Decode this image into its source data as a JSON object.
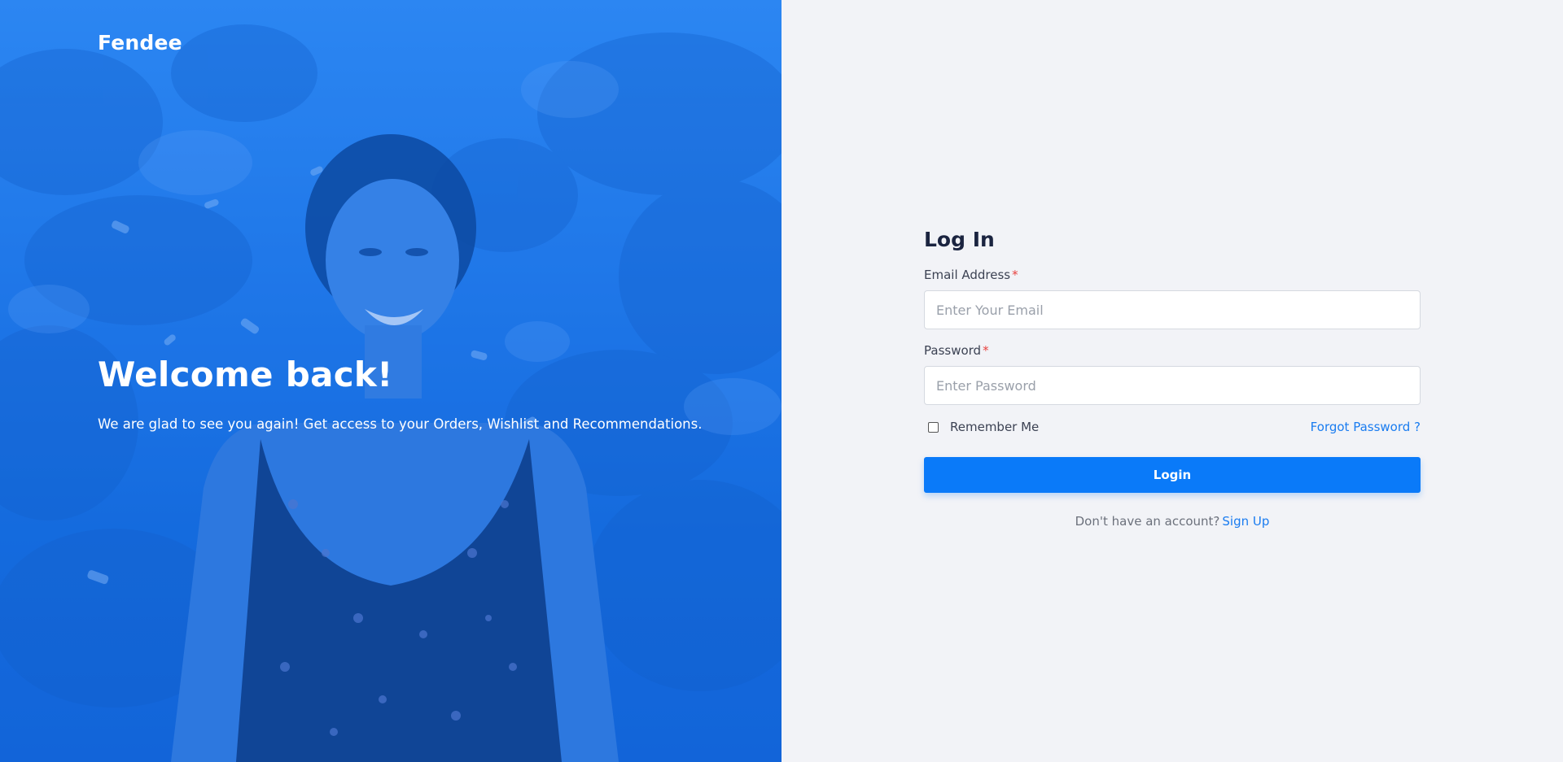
{
  "brand": {
    "name": "Fendee"
  },
  "hero": {
    "title": "Welcome back!",
    "subtitle": "We are glad to see you again! Get access to your Orders, Wishlist and Recommendations."
  },
  "login": {
    "title": "Log In",
    "email": {
      "label": "Email Address",
      "required_marker": "*",
      "placeholder": "Enter Your Email",
      "value": ""
    },
    "password": {
      "label": "Password",
      "required_marker": "*",
      "placeholder": "Enter Password",
      "value": ""
    },
    "remember_label": "Remember Me",
    "remember_checked": false,
    "forgot_label": "Forgot Password ?",
    "submit_label": "Login",
    "signup_prompt": "Don't have an account?",
    "signup_link": "Sign Up"
  },
  "colors": {
    "primary": "#0a7af9",
    "link": "#1a7cf0",
    "hero_blue": "#2a7ee8",
    "panel_bg": "#f2f3f7",
    "required": "#e8423f"
  },
  "icons": {
    "hero_image": "smiling-woman-photo"
  }
}
